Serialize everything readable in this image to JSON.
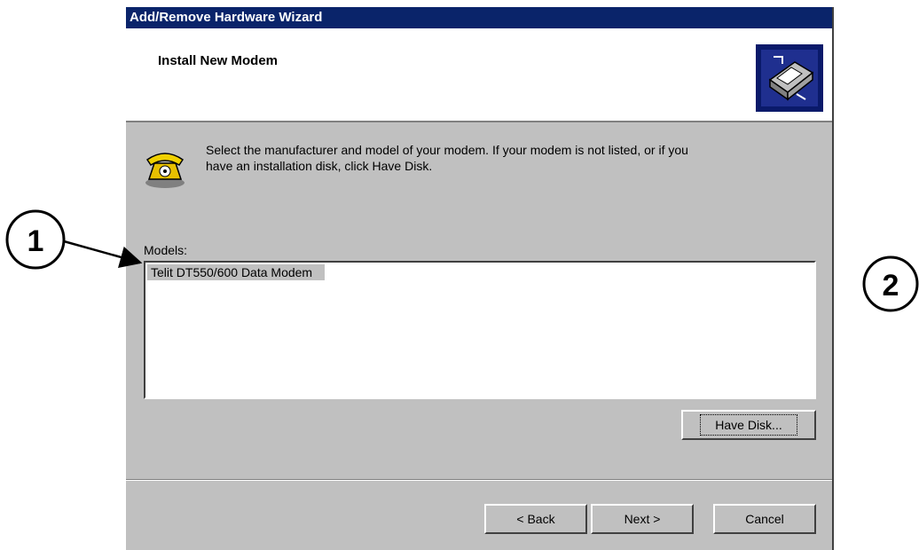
{
  "window": {
    "title": "Add/Remove Hardware Wizard"
  },
  "header": {
    "title": "Install New Modem",
    "icon": "hardware-wizard-icon"
  },
  "body": {
    "icon": "telephone-modem-icon",
    "description_line1": "Select the manufacturer and model of your modem. If your modem is not listed, or if you",
    "description_line2": "have an installation disk, click Have Disk.",
    "models_label": "Models:",
    "models": [
      "Telit DT550/600 Data Modem"
    ]
  },
  "buttons": {
    "have_disk": "Have Disk...",
    "back": "< Back",
    "next": "Next >",
    "cancel": "Cancel"
  },
  "callouts": [
    "1",
    "2"
  ],
  "colors": {
    "titlebar": "#0a246a",
    "dialog": "#c0c0c0",
    "selection": "#c0c0c0"
  }
}
